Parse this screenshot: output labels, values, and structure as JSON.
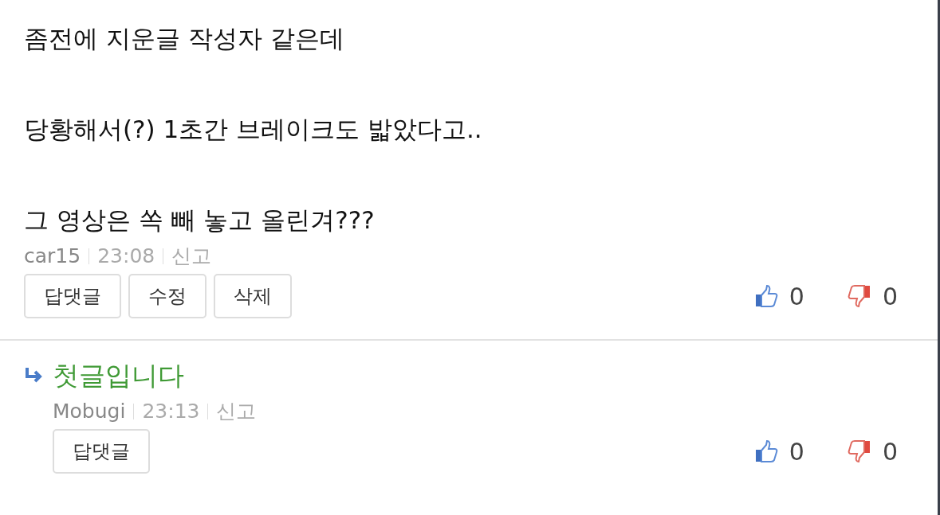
{
  "comments": [
    {
      "kind": "comment",
      "paragraphs": [
        "좀전에 지운글 작성자 같은데",
        "당황해서(?) 1초간 브레이크도 밟았다고..",
        "그 영상은 쏙 빼 놓고 올린겨???"
      ],
      "author": "car15",
      "time": "23:08",
      "report": "신고",
      "buttons": [
        "답댓글",
        "수정",
        "삭제"
      ],
      "likes": "0",
      "dislikes": "0"
    },
    {
      "kind": "reply",
      "paragraphs": [
        "첫글입니다"
      ],
      "author": "Mobugi",
      "time": "23:13",
      "report": "신고",
      "buttons": [
        "답댓글"
      ],
      "likes": "0",
      "dislikes": "0"
    }
  ]
}
